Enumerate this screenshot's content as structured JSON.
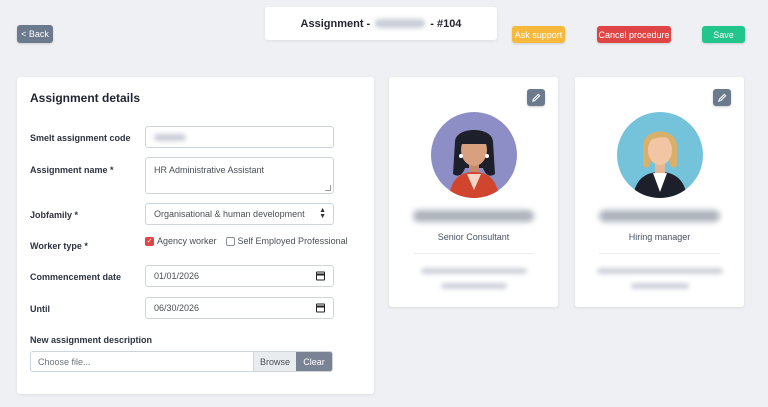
{
  "header": {
    "back_label": "< Back",
    "title_prefix": "Assignment -",
    "title_suffix": "- #104",
    "ask_support_label": "Ask support",
    "cancel_label": "Cancel procedure",
    "save_label": "Save"
  },
  "details": {
    "title": "Assignment details",
    "code_label": "Smelt assignment code",
    "name_label": "Assignment name *",
    "name_value": "HR Administrative Assistant",
    "jobfamily_label": "Jobfamily *",
    "jobfamily_value": "Organisational & human development",
    "worker_type_label": "Worker type *",
    "worker_type_options": [
      "Agency worker",
      "Self Employed Professional"
    ],
    "commencement_label": "Commencement date",
    "commencement_value": "01/01/2026",
    "until_label": "Until",
    "until_value": "06/30/2026",
    "description_label": "New assignment description",
    "file_placeholder": "Choose file...",
    "browse_label": "Browse",
    "clear_label": "Clear"
  },
  "people": [
    {
      "role": "Senior Consultant",
      "avatar_bg": "#8e8ec7"
    },
    {
      "role": "Hiring manager",
      "avatar_bg": "#74c3db"
    }
  ],
  "colors": {
    "back": "#6c7a8d",
    "support": "#f6b93b",
    "cancel": "#e04545",
    "save": "#22c58b"
  }
}
